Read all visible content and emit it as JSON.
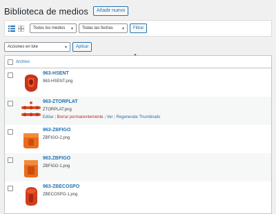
{
  "header": {
    "title": "Biblioteca de medios",
    "add_new": "Añadir nuevo"
  },
  "filters": {
    "media_type": "Todos los medios",
    "dates": "Todas las fechas",
    "filter_button": "Filtrar"
  },
  "bulk": {
    "action": "Acciones en lote",
    "apply": "Aplicar"
  },
  "table": {
    "column_file": "Archivo",
    "rows": [
      {
        "title": "963-HSENT",
        "filename": "963-HSENT.png"
      },
      {
        "title": "963-ZTORPLAT",
        "filename": "ZTORPLAT.png",
        "actions": {
          "edit": "Editar",
          "delete": "Borrar permanentemente",
          "view": "Ver",
          "regen": "Regenerate Thumbnails",
          "sep": "|"
        }
      },
      {
        "title": "963-ZBFIGO",
        "filename": "ZBFIGO-2.png"
      },
      {
        "title": "963.ZBFIGO",
        "filename": "ZBFIGO-1.png"
      },
      {
        "title": "963-ZBECOSPO",
        "filename": "ZBECOSPO-1.png"
      }
    ]
  },
  "colors": {
    "link": "#2271b1",
    "delete": "#b32d2e",
    "product_red": "#d43d1e",
    "product_orange": "#ec6a1c"
  },
  "icons": [
    "list-view-icon",
    "grid-view-icon",
    "chevron-down-icon",
    "mouse-cursor-icon"
  ]
}
